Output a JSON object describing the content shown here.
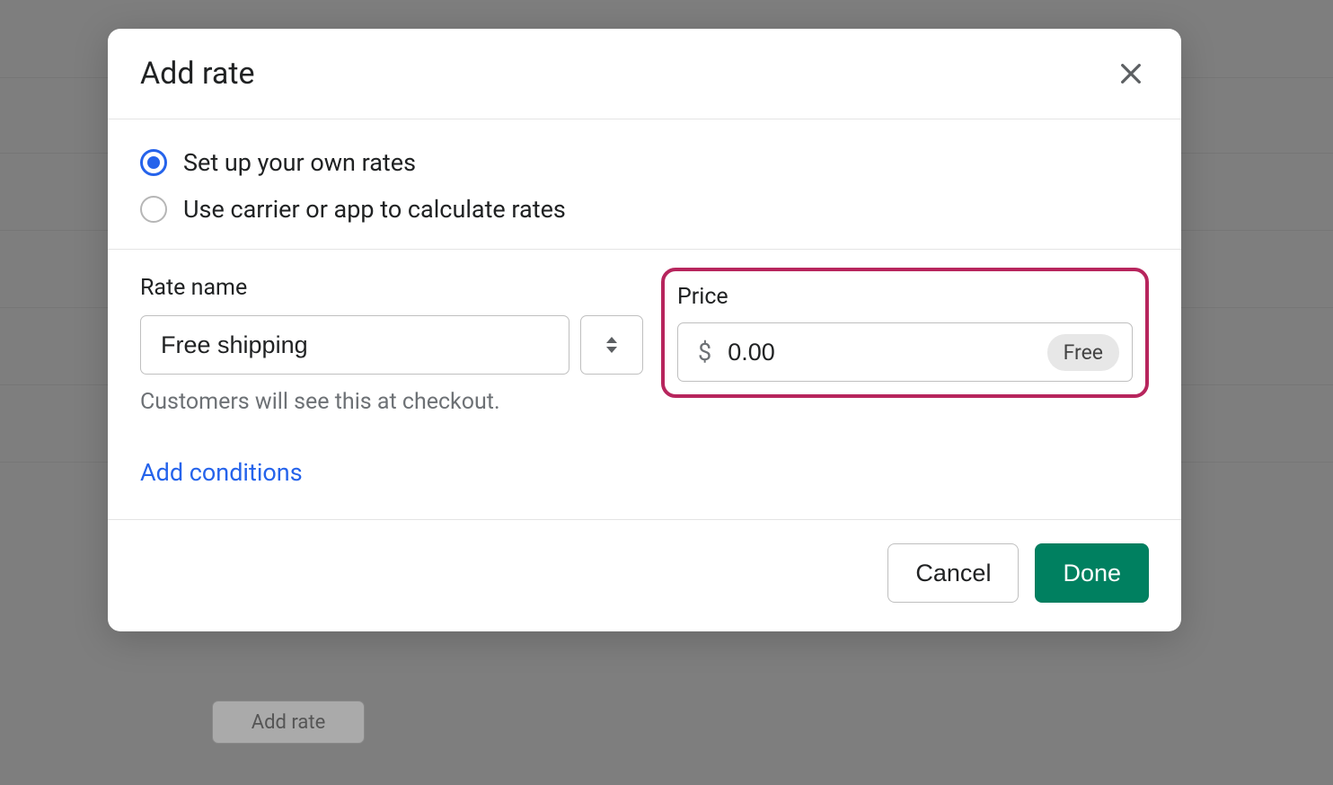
{
  "modal": {
    "title": "Add rate",
    "radios": {
      "own": "Set up your own rates",
      "carrier": "Use carrier or app to calculate rates"
    },
    "rateName": {
      "label": "Rate name",
      "value": "Free shipping",
      "help": "Customers will see this at checkout."
    },
    "price": {
      "label": "Price",
      "currency": "$",
      "value": "0.00",
      "badge": "Free"
    },
    "addConditions": "Add conditions",
    "footer": {
      "cancel": "Cancel",
      "done": "Done"
    }
  },
  "background": {
    "addRateButton": "Add rate"
  }
}
